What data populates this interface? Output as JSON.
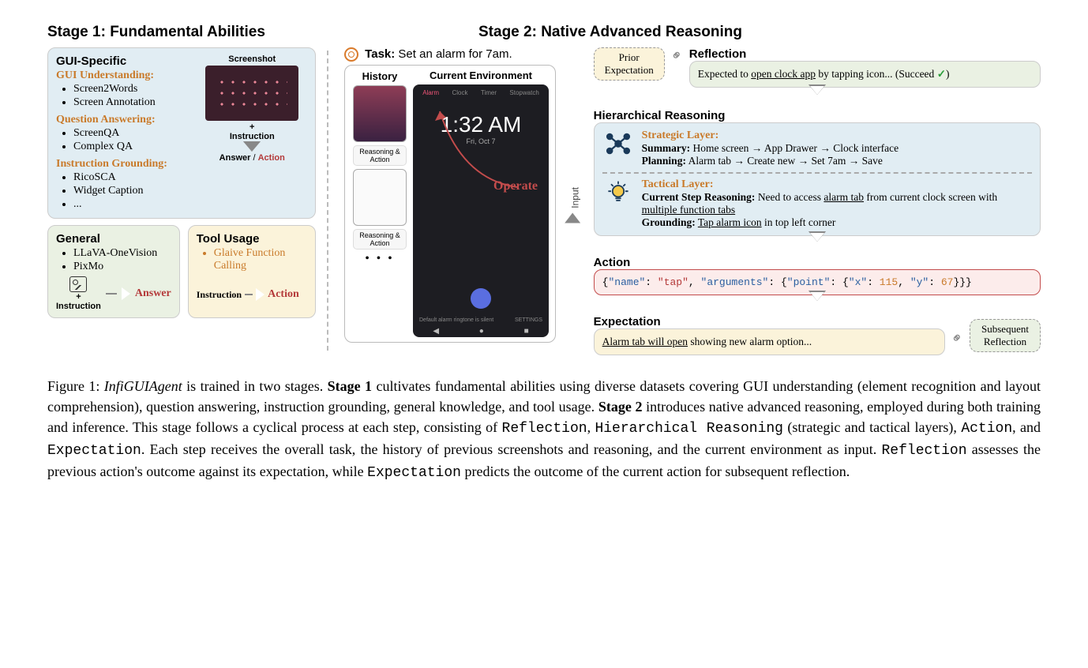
{
  "stage1": {
    "title": "Stage 1: Fundamental Abilities",
    "gui_specific": {
      "title": "GUI-Specific",
      "understanding_head": "GUI Understanding:",
      "understanding": [
        "Screen2Words",
        "Screen Annotation"
      ],
      "qa_head": "Question Answering:",
      "qa": [
        "ScreenQA",
        "Complex QA"
      ],
      "grounding_head": "Instruction Grounding:",
      "grounding": [
        "RicoSCA",
        "Widget Caption",
        "..."
      ],
      "screenshot_label": "Screenshot",
      "plus_label": "+",
      "instruction_label": "Instruction",
      "answer_label": "Answer",
      "action_label": "Action",
      "sep": " / "
    },
    "general": {
      "title": "General",
      "items": [
        "LLaVA-OneVision",
        "PixMo"
      ],
      "plus": "+",
      "instruction": "Instruction",
      "out": "Answer"
    },
    "tool": {
      "title": "Tool Usage",
      "items": [
        "Glaive Function Calling"
      ],
      "in": "Instruction",
      "out": "Action"
    }
  },
  "stage2": {
    "title": "Stage 2: Native Advanced Reasoning",
    "task_label": "Task:",
    "task_text": " Set an alarm for 7am.",
    "history_label": "History",
    "env_label": "Current Environment",
    "reasoning_action": "Reasoning & Action",
    "dots": "• • •",
    "phone": {
      "tabs": [
        "Alarm",
        "Clock",
        "Timer",
        "Stopwatch"
      ],
      "time": "1:32 AM",
      "date": "Fri, Oct 7",
      "operate": "Operate",
      "foot_left": "Default alarm ringtone is silent",
      "foot_right": "SETTINGS",
      "nav": [
        "◀",
        "●",
        "■"
      ]
    },
    "input_label": "Input",
    "prior_exp": "Prior Expectation",
    "reflection": {
      "title": "Reflection",
      "text_a": "Expected to ",
      "text_u": "open clock app",
      "text_b": " by tapping icon... (Succeed ",
      "check": "✓",
      "text_c": ")"
    },
    "hier": {
      "title": "Hierarchical Reasoning",
      "strategic_head": "Strategic Layer:",
      "summary_label": "Summary:",
      "summary_text": " Home screen → App Drawer → Clock interface",
      "planning_label": "Planning:",
      "planning_text": " Alarm tab → Create new → Set 7am → Save",
      "tactical_head": "Tactical Layer:",
      "csr_label": "Current Step Reasoning:",
      "csr_a": " Need to access ",
      "csr_u1": "alarm tab",
      "csr_b": " from current clock screen with ",
      "csr_u2": "multiple function tabs",
      "grounding_label": "Grounding:",
      "grounding_u": "Tap alarm icon",
      "grounding_b": " in top left corner"
    },
    "action": {
      "title": "Action",
      "json": "{\"name\": \"tap\", \"arguments\": {\"point\": {\"x\": 115, \"y\": 67}}}"
    },
    "expect": {
      "title": "Expectation",
      "text_u": "Alarm tab will open",
      "text_b": " showing new alarm option..."
    },
    "subseq": "Subsequent Reflection"
  },
  "caption": {
    "fig_label": "Figure 1: ",
    "agent_name": "InfiGUIAgent",
    "p1a": " is trained in two stages. ",
    "s1b": "Stage 1",
    "p1b": " cultivates fundamental abilities using diverse datasets covering GUI understanding (element recognition and layout comprehension), question answering, instruction grounding, general knowledge, and tool usage. ",
    "s2b": "Stage 2",
    "p1c": " introduces native advanced reasoning, employed during both training and inference. This stage follows a cyclical process at each step, consisting of ",
    "m1": "Reflection",
    "c1": ", ",
    "m2": "Hierarchical Reasoning",
    "p1d": " (strategic and tactical layers), ",
    "m3": "Action",
    "c2": ", and ",
    "m4": "Expectation",
    "p1e": ". Each step receives the overall task, the history of previous screenshots and reasoning, and the current environment as input. ",
    "m5": "Reflection",
    "p1f": " assesses the previous action's outcome against its expectation, while ",
    "m6": "Expectation",
    "p1g": " predicts the outcome of the current action for subsequent reflection."
  }
}
